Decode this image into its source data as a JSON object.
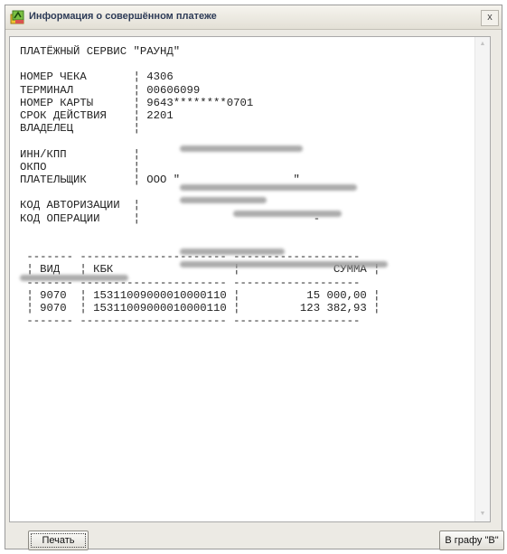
{
  "window": {
    "title": "Информация о совершённом платеже",
    "close_label": "x",
    "app_icon": "payment-app-icon"
  },
  "receipt": {
    "text": "ПЛАТЁЖНЫЙ СЕРВИС \"РАУНД\"\n\nНОМЕР ЧЕКА       ¦ 4306\nТЕРМИНАЛ         ¦ 00606099\nНОМЕР КАРТЫ      ¦ 9643********0701\nСРОК ДЕЙСТВИЯ    ¦ 2201\nВЛАДЕЛЕЦ         ¦\n\nИНН/КПП          ¦\nОКПО             ¦\nПЛАТЕЛЬЩИК       ¦ ООО \"                 \"\n\nКОД АВТОРИЗАЦИИ  ¦\nКОД ОПЕРАЦИИ     ¦                          -\n\n\n ------- ---------------------- -------------------\n ¦ ВИД   ¦ КБК                  ¦              СУММА ¦\n ------- ---------------------- -------------------\n ¦ 9070  ¦ 15311009000010000110 ¦          15 000,00 ¦\n ¦ 9070  ¦ 15311009000010000110 ¦         123 382,93 ¦\n ------- ---------------------- -------------------"
  },
  "buttons": {
    "print_label": "Печать",
    "column_label": "В графу \"В\""
  },
  "scrollbar": {
    "up_icon": "scroll-up-arrow-icon",
    "down_icon": "scroll-down-arrow-icon"
  }
}
